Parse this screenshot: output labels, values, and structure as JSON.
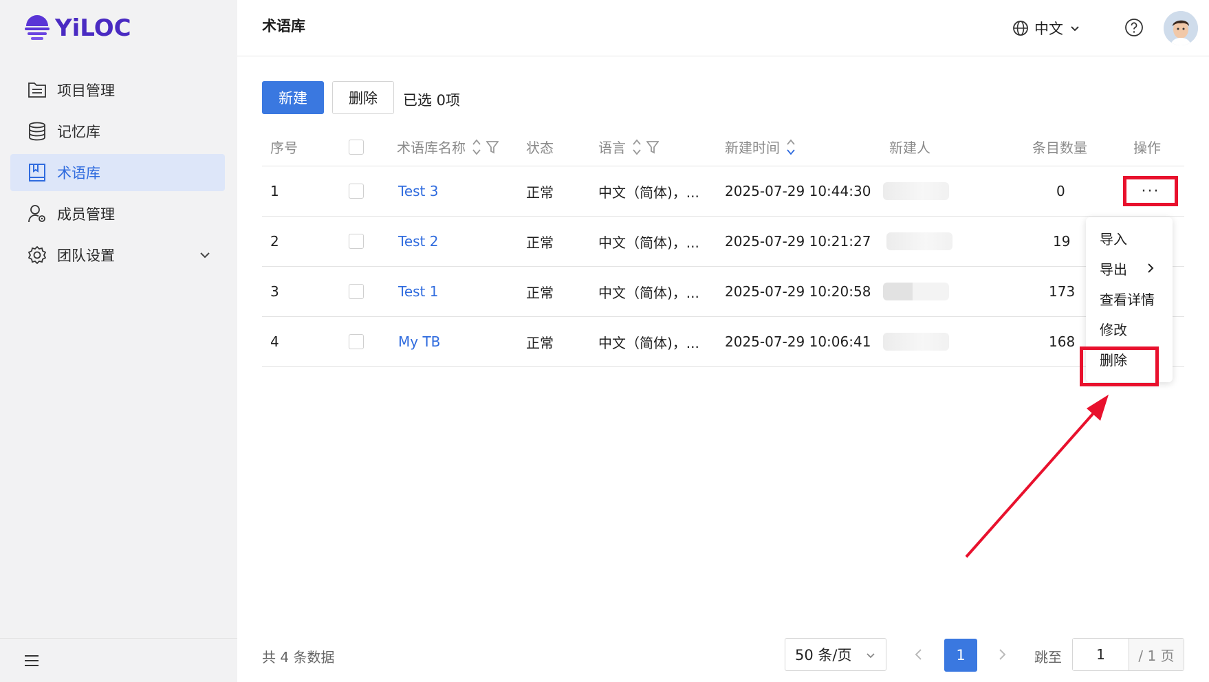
{
  "brand": {
    "name": "YiLOC",
    "color": "#4a2bc2"
  },
  "sidebar": {
    "items": [
      {
        "label": "项目管理",
        "icon": "folder-list-icon"
      },
      {
        "label": "记忆库",
        "icon": "database-icon"
      },
      {
        "label": "术语库",
        "icon": "book-icon",
        "active": true
      },
      {
        "label": "成员管理",
        "icon": "user-gear-icon"
      },
      {
        "label": "团队设置",
        "icon": "gear-icon",
        "expandable": true
      }
    ]
  },
  "header": {
    "title": "术语库",
    "language": "中文"
  },
  "toolbar": {
    "new_label": "新建",
    "delete_label": "删除",
    "selected_text": "已选 0项"
  },
  "table": {
    "columns": [
      "序号",
      "术语库名称",
      "状态",
      "语言",
      "新建时间",
      "新建人",
      "条目数量",
      "操作"
    ],
    "rows": [
      {
        "index": "1",
        "name": "Test 3",
        "status": "正常",
        "language": "中文（简体)，...",
        "created": "2025-07-29 10:44:30",
        "count": "0"
      },
      {
        "index": "2",
        "name": "Test 2",
        "status": "正常",
        "language": "中文（简体)，...",
        "created": "2025-07-29 10:21:27",
        "count": "19"
      },
      {
        "index": "3",
        "name": "Test 1",
        "status": "正常",
        "language": "中文（简体)，...",
        "created": "2025-07-29 10:20:58",
        "count": "173"
      },
      {
        "index": "4",
        "name": "My TB",
        "status": "正常",
        "language": "中文（简体)，...",
        "created": "2025-07-29 10:06:41",
        "count": "168"
      }
    ],
    "more_label": "···"
  },
  "action_menu": {
    "items": [
      "导入",
      "导出",
      "查看详情",
      "修改",
      "删除"
    ]
  },
  "pagination": {
    "total_text": "共 4 条数据",
    "page_size": "50 条/页",
    "current_page": "1",
    "jump_label": "跳至",
    "jump_value": "1",
    "total_pages_text": "/ 1 页"
  },
  "colors": {
    "primary": "#3a78e0",
    "highlight_red": "#e8112d",
    "sidebar_bg": "#f2f2f3",
    "active_bg": "#dde6f9"
  }
}
